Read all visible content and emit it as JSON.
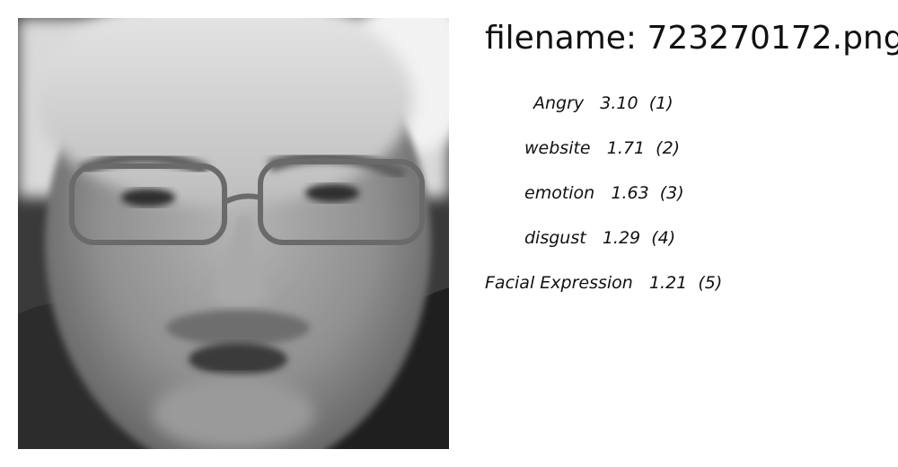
{
  "header": {
    "filename": "filename: 723270172.png"
  },
  "labels": [
    {
      "name": "Angry",
      "score": "3.10",
      "rank": "(1)"
    },
    {
      "name": "website",
      "score": "1.71",
      "rank": "(2)"
    },
    {
      "name": "emotion",
      "score": "1.63",
      "rank": "(3)"
    },
    {
      "name": "disgust",
      "score": "1.29",
      "rank": "(4)"
    },
    {
      "name": "Facial Expression",
      "score": "1.21",
      "rank": "(5)"
    }
  ]
}
